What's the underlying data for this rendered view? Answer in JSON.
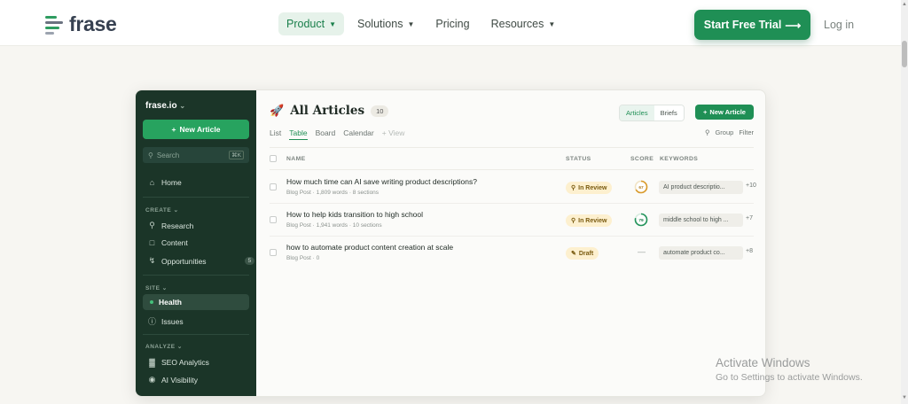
{
  "brand": {
    "name": "frase"
  },
  "nav": {
    "items": [
      {
        "label": "Product",
        "active": true,
        "has_menu": true
      },
      {
        "label": "Solutions",
        "active": false,
        "has_menu": true
      },
      {
        "label": "Pricing",
        "active": false,
        "has_menu": false
      },
      {
        "label": "Resources",
        "active": false,
        "has_menu": true
      }
    ],
    "cta": "Start Free Trial",
    "cta_arrow": "⟶",
    "login": "Log in"
  },
  "colors": {
    "brand_green": "#1f8f55",
    "sidebar_bg": "#1b3528",
    "review_badge": "#fdf0cf"
  },
  "app": {
    "workspace": "frase.io",
    "workspace_chevron": "⌄",
    "new_article": "New Article",
    "search_placeholder": "Search",
    "search_shortcut": "⌘K",
    "home": "Home",
    "create_section": "CREATE",
    "create_items": [
      {
        "label": "Research",
        "icon": "search-icon"
      },
      {
        "label": "Content",
        "icon": "document-icon"
      },
      {
        "label": "Opportunities",
        "icon": "lightning-icon",
        "count": "5"
      }
    ],
    "site_section": "SITE",
    "site_items": [
      {
        "label": "Health",
        "active": true
      },
      {
        "label": "Issues",
        "icon": "alert-icon"
      }
    ],
    "analyze_section": "ANALYZE",
    "analyze_items": [
      {
        "label": "SEO Analytics",
        "icon": "bar-chart-icon"
      },
      {
        "label": "AI Visibility",
        "icon": "eye-icon"
      }
    ]
  },
  "main": {
    "title": "All Articles",
    "count": "10",
    "views": [
      "List",
      "Table",
      "Board",
      "Calendar"
    ],
    "active_view": "Table",
    "add_view": "+ View",
    "toggle": [
      "Articles",
      "Briefs"
    ],
    "active_toggle": "Articles",
    "new_article": "New Article",
    "tools": [
      "Group",
      "Filter"
    ],
    "columns": {
      "name": "NAME",
      "status": "STATUS",
      "score": "SCORE",
      "keywords": "KEYWORDS"
    },
    "rows": [
      {
        "title": "How much time can AI save writing product descriptions?",
        "meta": "Blog Post · 1,809 words · 8 sections",
        "status": "In Review",
        "score": "67",
        "score_value": 67,
        "keyword": "AI product descriptio...",
        "more": "+10"
      },
      {
        "title": "How to help kids transition to high school",
        "meta": "Blog Post · 1,941 words · 10 sections",
        "status": "In Review",
        "score": "79",
        "score_value": 79,
        "keyword": "middle school to high ...",
        "more": "+7"
      },
      {
        "title": "how to automate product content creation at scale",
        "meta": "Blog Post · 0",
        "status": "Draft",
        "score": "—",
        "keyword": "automate product co...",
        "more": "+8"
      }
    ]
  },
  "watermark": {
    "line1": "Activate Windows",
    "line2": "Go to Settings to activate Windows."
  }
}
